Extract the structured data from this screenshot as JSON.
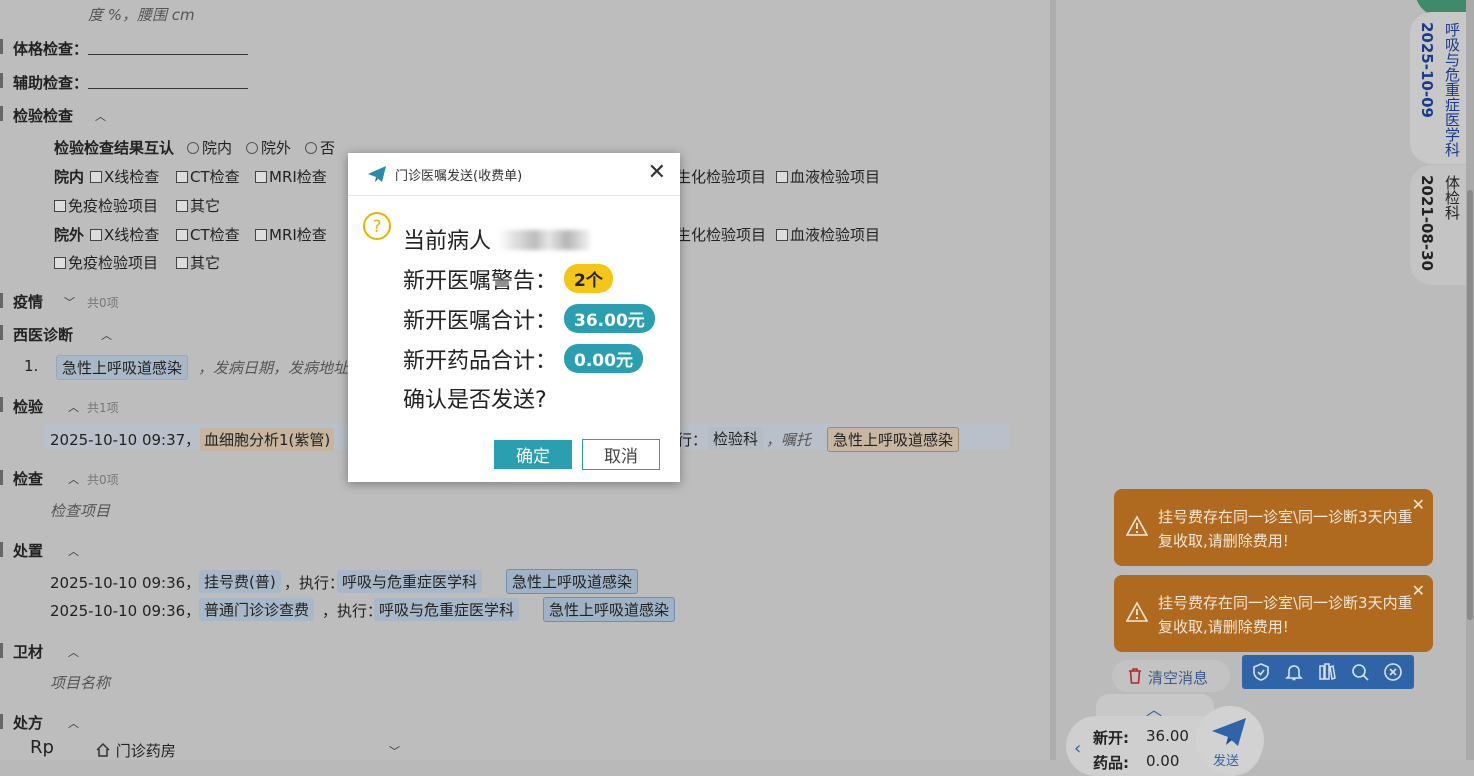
{
  "record": {
    "top_hint": "度 %，腰围 cm",
    "physical_exam_label": "体格检查：",
    "aux_exam_label": "辅助检查：",
    "lab_exam_label": "检验检查",
    "mutual_label": "检验检查结果互认",
    "mutual_opts": [
      "院内",
      "院外",
      "否"
    ],
    "in_label": "院内",
    "out_label": "院外",
    "row_items": [
      "X线检查",
      "CT检查",
      "MRI检查"
    ],
    "row_items_right": [
      "生化检验项目",
      "血液检验项目"
    ],
    "row2_items": [
      "免疫检验项目",
      "其它"
    ],
    "epidemic_label": "疫情",
    "epidemic_count": "共0项",
    "western_dx_label": "西医诊断",
    "dx_index": "1.",
    "dx_name": "急性上呼吸道感染",
    "dx_suffix": "，发病日期，发病地址",
    "lab_label": "检验",
    "lab_count": "共1项",
    "lab_time": "2025-10-10 09:37，",
    "lab_item": "血细胞分析1(紫管)",
    "lab_exec": "行：",
    "lab_exec_dept": "检验科",
    "lab_advice": "，嘱托",
    "lab_dx": "急性上呼吸道感染",
    "check_label": "检查",
    "check_count": "共0项",
    "check_placeholder": "检查项目",
    "treat_label": "处置",
    "treat_rows": [
      {
        "time": "2025-10-10 09:36，",
        "item": "挂号费(普)",
        "exec": "，执行：",
        "dept": "呼吸与危重症医学科",
        "dx": "急性上呼吸道感染"
      },
      {
        "time": "2025-10-10 09:36，",
        "item": "普通门诊诊查费",
        "exec": "，执行：",
        "dept": "呼吸与危重症医学科",
        "dx": "急性上呼吸道感染"
      }
    ],
    "material_label": "卫材",
    "material_placeholder": "项目名称",
    "rx_label": "处方",
    "rp": "Rp",
    "pharmacy": "门诊药房"
  },
  "sidebar": {
    "tabs": [
      {
        "date": "2025-10-09",
        "dept": "呼吸与危重症医学科"
      },
      {
        "date": "2021-08-30",
        "dept": "体检科"
      }
    ],
    "toasts": [
      {
        "text": "挂号费存在同一诊室\\同一诊断3天内重复收取,请删除费用!"
      },
      {
        "text": "挂号费存在同一诊室\\同一诊断3天内重复收取,请删除费用!"
      }
    ],
    "clear_label": "清空消息",
    "new_label": "新开:",
    "new_value": "36.00",
    "drug_label": "药品:",
    "drug_value": "0.00",
    "send_label": "发送"
  },
  "dialog": {
    "title": "门诊医嘱发送(收费单)",
    "patient_label": "当前病人",
    "warn_label": "新开医嘱警告：",
    "warn_value": "2个",
    "total_label": "新开医嘱合计：",
    "total_value": "36.00元",
    "drug_label": "新开药品合计：",
    "drug_value": "0.00元",
    "confirm_text": "确认是否发送?",
    "ok_label": "确定",
    "cancel_label": "取消"
  },
  "colors": {
    "accent": "#2a9fb0",
    "warn_pill": "#f5c518",
    "toast": "#b06a20",
    "toolbar": "#2f64a8"
  }
}
